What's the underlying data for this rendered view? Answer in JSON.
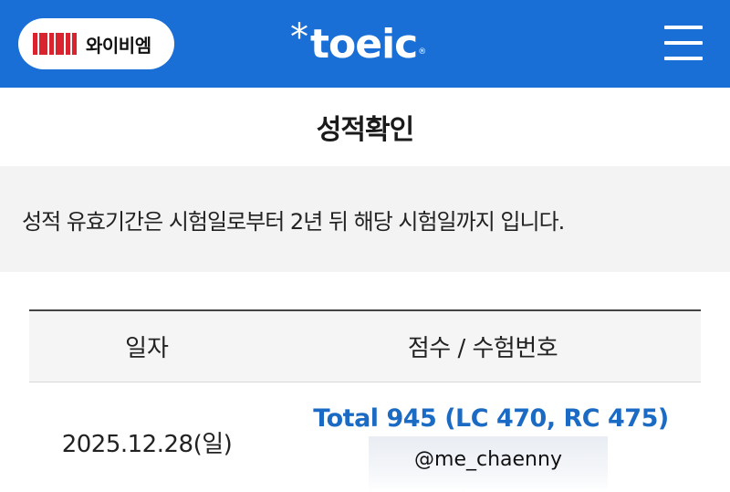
{
  "header": {
    "ybm_logo_text": "와이비엠",
    "ybm_mark_text": "YBM",
    "toeic_logo_text": "toeic",
    "toeic_star": "*",
    "toeic_reg": "®",
    "brand_color": "#1a6fd6"
  },
  "page": {
    "title": "성적확인"
  },
  "notice": {
    "text": "성적 유효기간은 시험일로부터 2년 뒤 해당 시험일까지 입니다."
  },
  "table": {
    "headers": {
      "date": "일자",
      "score": "점수 / 수험번호"
    },
    "rows": [
      {
        "date": "2025.12.28(일)",
        "score": "Total 945 (LC 470, RC 475)",
        "exam_number": "@me_chaenny"
      }
    ],
    "score_color": "#1b6bc4"
  }
}
